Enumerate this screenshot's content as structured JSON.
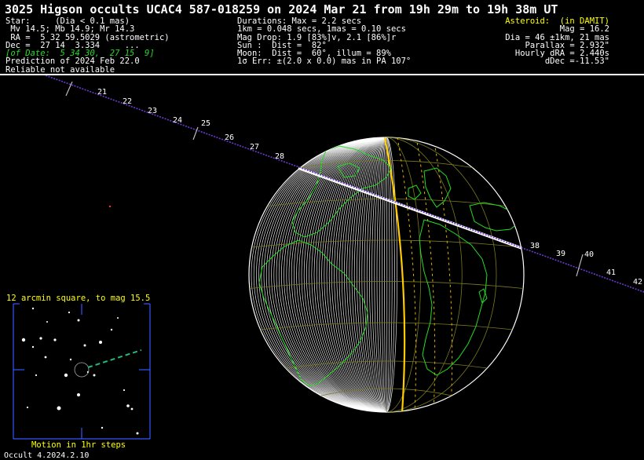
{
  "title": "3025 Higson occults UCAC4 587-018259 on 2024 Mar 21 from 19h 29m to 19h 38m UT",
  "star": {
    "l1": "Star:     (Dia < 0.1 mas)",
    "l2": " Mv 14.5; Mb 14.9; Mr 14.3",
    "l3": " RA =  5 32 59.5029 (astrometric)",
    "l4": "Dec =  27 14  3.334     ...",
    "l5": "[of Date:  5 34 30,  27 15  9]",
    "l6": "Prediction of 2024 Feb 22.0",
    "l7": "Reliable not available"
  },
  "event": {
    "l1": "Durations: Max = 2.2 secs",
    "l2": "1km = 0.048 secs, 1mas = 0.10 secs",
    "l3": "Mag Drop: 1.9 [83%]v, 2.1 [86%]r",
    "l4": "Sun :  Dist =  82°",
    "l5": "Moon:  Dist =  60°, illum = 89%",
    "l6": "1σ Err: ±(2.0 x 0.0) mas in PA 107°"
  },
  "asteroid": {
    "l1": "Asteroid:  (in DAMIT)",
    "l2": "Mag = 16.2",
    "l3": "Dia = 46 ±1km, 21 mas",
    "l4": "Parallax = 2.932\"",
    "l5": "Hourly dRA = 2.440s",
    "l6": "dDec =-11.53\""
  },
  "path_minutes": [
    "21",
    "22",
    "23",
    "24",
    "25",
    "26",
    "27",
    "28",
    "38",
    "39",
    "40",
    "41",
    "42"
  ],
  "inset": {
    "title": "12 arcmin square, to mag 15.5",
    "footer": "Motion in 1hr steps"
  },
  "version": "Occult 4.2024.2.10",
  "colors": {
    "background": "#000000",
    "text": "#ffffff",
    "highlight": "#ffff00",
    "coast": "#22dd22",
    "path": "#6a3ad0",
    "inset_frame": "#3355ff"
  }
}
